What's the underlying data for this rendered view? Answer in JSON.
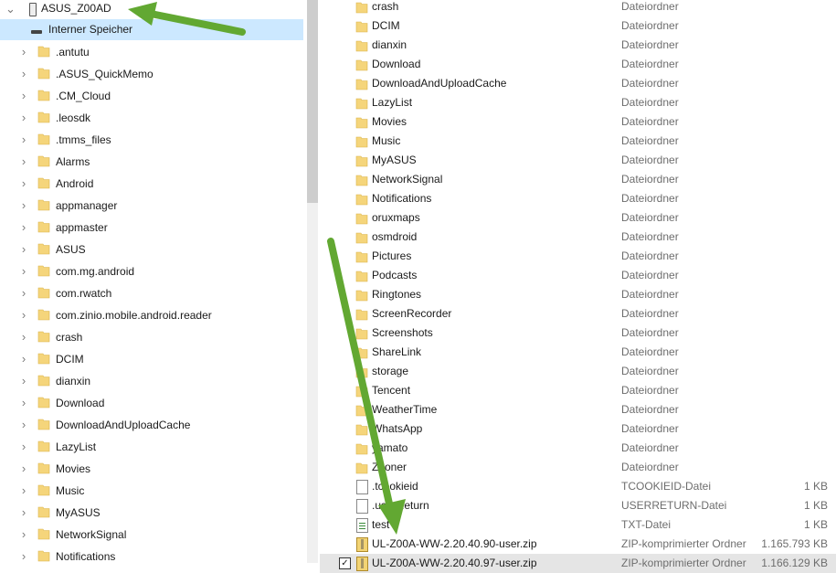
{
  "tree": {
    "device": "ASUS_Z00AD",
    "storage": "Interner Speicher",
    "folders": [
      ".antutu",
      ".ASUS_QuickMemo",
      ".CM_Cloud",
      ".leosdk",
      ".tmms_files",
      "Alarms",
      "Android",
      "appmanager",
      "appmaster",
      "ASUS",
      "com.mg.android",
      "com.rwatch",
      "com.zinio.mobile.android.reader",
      "crash",
      "DCIM",
      "dianxin",
      "Download",
      "DownloadAndUploadCache",
      "LazyList",
      "Movies",
      "Music",
      "MyASUS",
      "NetworkSignal",
      "Notifications"
    ]
  },
  "files": [
    {
      "name": "crash",
      "type": "Dateiordner",
      "size": "",
      "icon": "folder-icon"
    },
    {
      "name": "DCIM",
      "type": "Dateiordner",
      "size": "",
      "icon": "folder-icon"
    },
    {
      "name": "dianxin",
      "type": "Dateiordner",
      "size": "",
      "icon": "folder-icon"
    },
    {
      "name": "Download",
      "type": "Dateiordner",
      "size": "",
      "icon": "folder-icon"
    },
    {
      "name": "DownloadAndUploadCache",
      "type": "Dateiordner",
      "size": "",
      "icon": "folder-icon"
    },
    {
      "name": "LazyList",
      "type": "Dateiordner",
      "size": "",
      "icon": "folder-icon"
    },
    {
      "name": "Movies",
      "type": "Dateiordner",
      "size": "",
      "icon": "folder-icon"
    },
    {
      "name": "Music",
      "type": "Dateiordner",
      "size": "",
      "icon": "folder-icon"
    },
    {
      "name": "MyASUS",
      "type": "Dateiordner",
      "size": "",
      "icon": "folder-icon"
    },
    {
      "name": "NetworkSignal",
      "type": "Dateiordner",
      "size": "",
      "icon": "folder-icon"
    },
    {
      "name": "Notifications",
      "type": "Dateiordner",
      "size": "",
      "icon": "folder-icon"
    },
    {
      "name": "oruxmaps",
      "type": "Dateiordner",
      "size": "",
      "icon": "folder-icon"
    },
    {
      "name": "osmdroid",
      "type": "Dateiordner",
      "size": "",
      "icon": "folder-icon"
    },
    {
      "name": "Pictures",
      "type": "Dateiordner",
      "size": "",
      "icon": "folder-icon"
    },
    {
      "name": "Podcasts",
      "type": "Dateiordner",
      "size": "",
      "icon": "folder-icon"
    },
    {
      "name": "Ringtones",
      "type": "Dateiordner",
      "size": "",
      "icon": "folder-icon"
    },
    {
      "name": "ScreenRecorder",
      "type": "Dateiordner",
      "size": "",
      "icon": "folder-icon"
    },
    {
      "name": "Screenshots",
      "type": "Dateiordner",
      "size": "",
      "icon": "folder-icon"
    },
    {
      "name": "ShareLink",
      "type": "Dateiordner",
      "size": "",
      "icon": "folder-icon"
    },
    {
      "name": "storage",
      "type": "Dateiordner",
      "size": "",
      "icon": "folder-icon"
    },
    {
      "name": "Tencent",
      "type": "Dateiordner",
      "size": "",
      "icon": "folder-icon"
    },
    {
      "name": "WeatherTime",
      "type": "Dateiordner",
      "size": "",
      "icon": "folder-icon"
    },
    {
      "name": "WhatsApp",
      "type": "Dateiordner",
      "size": "",
      "icon": "folder-icon"
    },
    {
      "name": "yamato",
      "type": "Dateiordner",
      "size": "",
      "icon": "folder-icon"
    },
    {
      "name": "Zooner",
      "type": "Dateiordner",
      "size": "",
      "icon": "folder-icon"
    },
    {
      "name": ".tcookieid",
      "type": "TCOOKIEID-Datei",
      "size": "1 KB",
      "icon": "file-icon"
    },
    {
      "name": ".userReturn",
      "type": "USERRETURN-Datei",
      "size": "1 KB",
      "icon": "file-icon"
    },
    {
      "name": "test",
      "type": "TXT-Datei",
      "size": "1 KB",
      "icon": "text-file-icon"
    },
    {
      "name": "UL-Z00A-WW-2.20.40.90-user.zip",
      "type": "ZIP-komprimierter Ordner",
      "size": "1.165.793 KB",
      "icon": "zip-icon"
    },
    {
      "name": "UL-Z00A-WW-2.20.40.97-user.zip",
      "type": "ZIP-komprimierter Ordner",
      "size": "1.166.129 KB",
      "icon": "zip-icon",
      "selected": true
    }
  ],
  "colors": {
    "selection": "#cce8ff",
    "selected_row": "#e5e5e5",
    "arrow": "#62a832",
    "folder": "#f5d57b"
  }
}
